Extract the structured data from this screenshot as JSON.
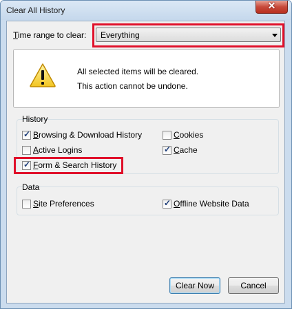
{
  "window": {
    "title": "Clear All History",
    "close_glyph": "✕"
  },
  "time_range": {
    "label_prefix": "T",
    "label_rest": "ime range to clear:",
    "selected": "Everything"
  },
  "warning": {
    "icon": "warning-icon",
    "line1": "All selected items will be cleared.",
    "line2": "This action cannot be undone."
  },
  "history": {
    "title": "History",
    "items": [
      {
        "u": "B",
        "rest": "rowsing & Download History",
        "checked": true
      },
      {
        "u": "A",
        "rest": "ctive Logins",
        "checked": false
      },
      {
        "u": "F",
        "rest": "orm & Search History",
        "checked": true
      },
      {
        "u": "C",
        "rest": "ookies",
        "checked": false
      },
      {
        "u": "C",
        "rest": "ache",
        "checked": true
      }
    ]
  },
  "data": {
    "title": "Data",
    "items": [
      {
        "u": "S",
        "rest": "ite Preferences",
        "checked": false
      },
      {
        "u": "O",
        "rest": "ffline Website Data",
        "checked": true
      }
    ]
  },
  "buttons": {
    "clear_now": "Clear Now",
    "cancel": "Cancel"
  },
  "colors": {
    "highlight": "#e0102a"
  }
}
